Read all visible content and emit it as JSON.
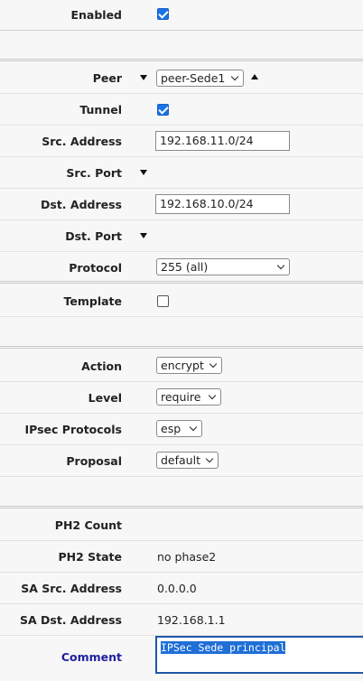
{
  "rows": {
    "enabled": {
      "label": "Enabled",
      "checked": true
    },
    "peer": {
      "label": "Peer",
      "value": "peer-Sede1"
    },
    "tunnel": {
      "label": "Tunnel",
      "checked": true
    },
    "src_address": {
      "label": "Src. Address",
      "value": "192.168.11.0/24"
    },
    "src_port": {
      "label": "Src. Port"
    },
    "dst_address": {
      "label": "Dst. Address",
      "value": "192.168.10.0/24"
    },
    "dst_port": {
      "label": "Dst. Port"
    },
    "protocol": {
      "label": "Protocol",
      "value": "255 (all)"
    },
    "template": {
      "label": "Template",
      "checked": false
    },
    "action": {
      "label": "Action",
      "value": "encrypt"
    },
    "level": {
      "label": "Level",
      "value": "require"
    },
    "ipsec_protocols": {
      "label": "IPsec Protocols",
      "value": "esp"
    },
    "proposal": {
      "label": "Proposal",
      "value": "default"
    },
    "ph2_count": {
      "label": "PH2 Count",
      "value": ""
    },
    "ph2_state": {
      "label": "PH2 State",
      "value": "no phase2"
    },
    "sa_src_address": {
      "label": "SA Src. Address",
      "value": "0.0.0.0"
    },
    "sa_dst_address": {
      "label": "SA Dst. Address",
      "value": "192.168.1.1"
    },
    "comment": {
      "label": "Comment",
      "value": "IPSec Sede principal"
    }
  },
  "colors": {
    "checkbox": "#1a73e8",
    "comment_label": "#1f1fa0",
    "selection": "#1f6fd6"
  }
}
